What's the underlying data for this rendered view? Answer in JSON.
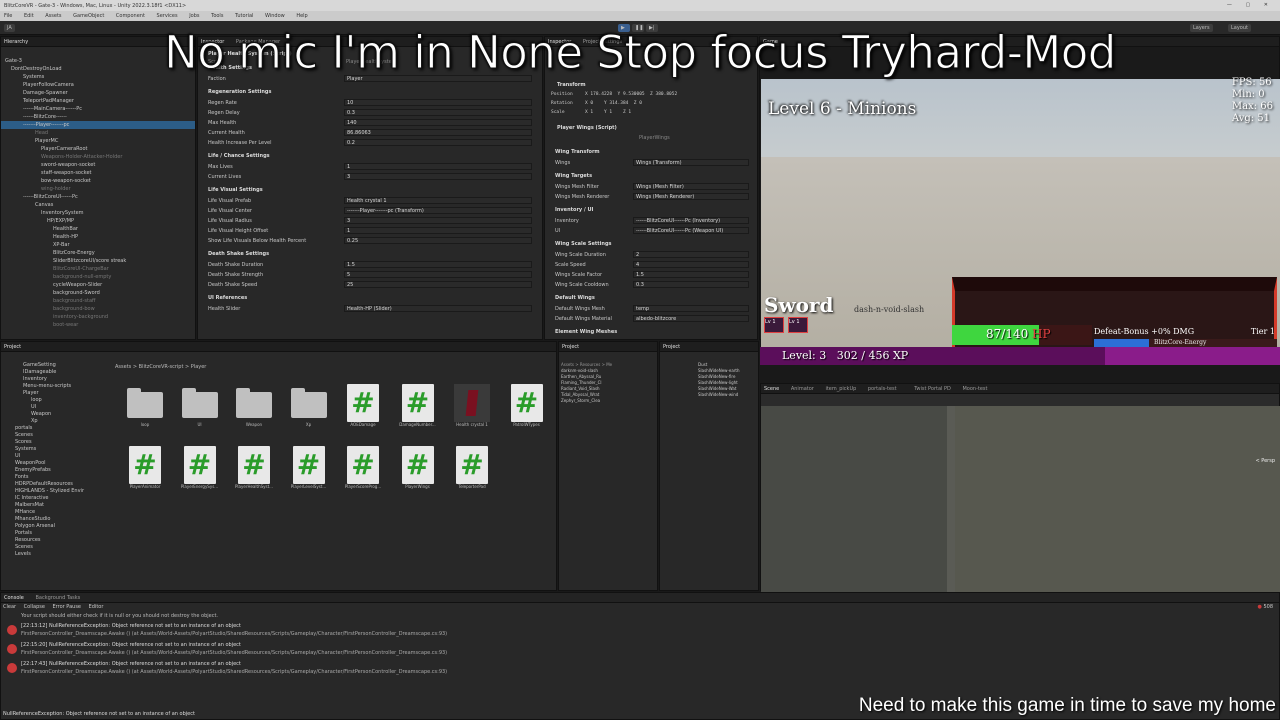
{
  "window": {
    "title": "BlitzCoreVR - Gate-3 - Windows, Mac, Linux - Unity 2022.3.18f1 <DX11>",
    "menu": [
      "File",
      "Edit",
      "Assets",
      "GameObject",
      "Component",
      "Services",
      "Jobs",
      "Tools",
      "Tutorial",
      "Window",
      "Help"
    ]
  },
  "toolbar": {
    "account": "JA",
    "layers_label": "Layers",
    "layout_label": "Layout"
  },
  "overlay": {
    "title": "No mic I'm in None Stop focus Tryhard-Mod",
    "caption": "Need to make this game in time to save my home"
  },
  "hierarchy": {
    "tab_label": "Hierarchy",
    "items": [
      {
        "label": "Gate-3",
        "dim": false
      },
      {
        "label": "DontDestroyOnLoad",
        "dim": false
      },
      {
        "label": "Systems",
        "dim": false
      },
      {
        "label": "PlayerFollowCamera",
        "dim": false
      },
      {
        "label": "Damage-Spawner",
        "dim": false
      },
      {
        "label": "TeleportPadManager",
        "dim": false
      },
      {
        "label": "------MainCamera------Pc",
        "dim": false
      },
      {
        "label": "------BlitzCore------",
        "dim": false
      },
      {
        "label": "-------Player-------pc",
        "dim": false,
        "selected": true
      },
      {
        "label": "Head",
        "dim": true
      },
      {
        "label": "PlayerMC",
        "dim": false
      },
      {
        "label": "PlayerCameraRoot",
        "dim": false
      },
      {
        "label": "Weapons-Holder-Attacker-Holder",
        "dim": true
      },
      {
        "label": "sword-weapon-socket",
        "dim": false
      },
      {
        "label": "staff-weapon-socket",
        "dim": false
      },
      {
        "label": "bow-weapon-socket",
        "dim": false
      },
      {
        "label": "wing-holder",
        "dim": true
      },
      {
        "label": "------BlitzCoreUI------Pc",
        "dim": false
      },
      {
        "label": "Canvas",
        "dim": false
      },
      {
        "label": "InventorySystem",
        "dim": false
      },
      {
        "label": "HP/EXP/MP",
        "dim": false
      },
      {
        "label": "HealthBar",
        "dim": false
      },
      {
        "label": "Health-HP",
        "dim": false
      },
      {
        "label": "XP-Bar",
        "dim": false
      },
      {
        "label": "BlitzCore-Energy",
        "dim": false
      },
      {
        "label": "SliderBlitzcoreUI/score streak",
        "dim": false
      },
      {
        "label": "BlitzCoreUI-ChargeBar",
        "dim": true
      },
      {
        "label": "background-null-empty",
        "dim": true
      },
      {
        "label": "cycleWeapon-Slider",
        "dim": false
      },
      {
        "label": "background-Sword",
        "dim": false
      },
      {
        "label": "background-staff",
        "dim": true
      },
      {
        "label": "background-bow",
        "dim": true
      },
      {
        "label": "inventory-background",
        "dim": true
      },
      {
        "label": "boot-wear",
        "dim": true
      }
    ]
  },
  "inspector": {
    "tabs": [
      "Inspector",
      "Package Manager"
    ],
    "component": "Player Health System (Script)",
    "script_label": "Script",
    "script_value": "PlayerHealthSystem",
    "sections": [
      {
        "header": "Health Settings",
        "rows": [
          {
            "label": "Faction",
            "value": "Player"
          }
        ]
      },
      {
        "header": "Regeneration Settings",
        "rows": [
          {
            "label": "Regen Rate",
            "value": "10"
          },
          {
            "label": "Regen Delay",
            "value": "0.3"
          },
          {
            "label": "Max Health",
            "value": "140"
          },
          {
            "label": "Current Health",
            "value": "86.86063"
          },
          {
            "label": "Health Increase Per Level",
            "value": "0.2"
          }
        ]
      },
      {
        "header": "Life / Chance Settings",
        "rows": [
          {
            "label": "Max Lives",
            "value": "1"
          },
          {
            "label": "Current Lives",
            "value": "3"
          }
        ]
      },
      {
        "header": "Life Visual Settings",
        "rows": [
          {
            "label": "Life Visual Prefab",
            "value": "Health crystal 1"
          },
          {
            "label": "Life Visual Center",
            "value": "-------Player-------pc (Transform)"
          },
          {
            "label": "Life Visual Radius",
            "value": "3"
          },
          {
            "label": "Life Visual Height Offset",
            "value": "1"
          },
          {
            "label": "Show Life Visuals Below Health Percent",
            "value": "0.25"
          }
        ]
      },
      {
        "header": "Death Shake Settings",
        "rows": [
          {
            "label": "Death Shake Duration",
            "value": "1.5"
          },
          {
            "label": "Death Shake Strength",
            "value": "5"
          },
          {
            "label": "Death Shake Speed",
            "value": "25"
          }
        ]
      },
      {
        "header": "UI References",
        "rows": [
          {
            "label": "Health Slider",
            "value": "Health-HP (Slider)"
          }
        ]
      }
    ]
  },
  "inspector2": {
    "tabs": [
      "Inspector",
      "Project Settings"
    ],
    "transform": {
      "header": "Transform",
      "position": [
        "178.4228",
        "9.530005",
        "380.8052"
      ],
      "rotation": [
        "0",
        "314.384",
        "0"
      ],
      "scale": [
        "1",
        "1",
        "1"
      ]
    },
    "component": "Player Wings (Script)",
    "script_value": "PlayerWings",
    "sections": [
      {
        "header": "Wing Transform",
        "rows": [
          {
            "label": "Wings",
            "value": "Wings (Transform)"
          }
        ]
      },
      {
        "header": "Wing Targets",
        "rows": [
          {
            "label": "Wings Mesh Filter",
            "value": "Wings (Mesh Filter)"
          },
          {
            "label": "Wings Mesh Renderer",
            "value": "Wings (Mesh Renderer)"
          }
        ]
      },
      {
        "header": "Inventory / UI",
        "rows": [
          {
            "label": "Inventory",
            "value": "------BlitzCoreUI------Pc (Inventory)"
          },
          {
            "label": "UI",
            "value": "------BlitzCoreUI------Pc (Weapon UI)"
          }
        ]
      },
      {
        "header": "Wing Scale Settings",
        "rows": [
          {
            "label": "Wing Scale Duration",
            "value": "2"
          },
          {
            "label": "Scale Speed",
            "value": "4"
          },
          {
            "label": "Wings Scale Factor",
            "value": "1.5"
          },
          {
            "label": "Wing Scale Cooldown",
            "value": "0.3"
          }
        ]
      },
      {
        "header": "Default Wings",
        "rows": [
          {
            "label": "Default Wings Mesh",
            "value": "temp"
          },
          {
            "label": "Default Wings Material",
            "value": "albedo-blitzcore"
          }
        ]
      },
      {
        "header": "Element Wing Meshes",
        "rows": []
      }
    ]
  },
  "game": {
    "tabs": [
      "Game"
    ],
    "level_title": "Level 6 - Minions",
    "fps": "FPS: 56",
    "min": "Min: 0",
    "max": "Max: 66",
    "avg": "Avg: 51",
    "weapon": "Sword",
    "dash_text": "dash-n-void-slash",
    "slot_labels": [
      "Lv 1",
      "Lv 1"
    ],
    "player_level": "Level: 3",
    "xp_text": "302 / 456 XP",
    "xp_current": 302,
    "xp_max": 456,
    "hp_text": "87/140",
    "hp_unit": "HP",
    "hp_current": 87,
    "hp_max": 140,
    "defeat_text": "Defeat-Bonus +0% DMG",
    "tier_text": "Tier 1",
    "energy_text": "BlitzCore-Energy",
    "energy_fill": 0.3
  },
  "project": {
    "tabs": [
      "Project"
    ],
    "breadcrumb": "Assets > BlitzCoreVR-script > Player",
    "folders": [
      "GameSetting",
      "IDamageable",
      "Inventory",
      "Menu-menu-scripts",
      "Player",
      "loop",
      "UI",
      "Weapon",
      "Xp",
      "portals",
      "Scenes",
      "Scores",
      "Systems",
      "UI",
      "WeaponPool",
      "EnemyPrefabs",
      "Fonts",
      "HDRPDefaultResources",
      "HIGHLANDS - Stylized Envir",
      "IC Interactive",
      "MalbersMat",
      "MHance",
      "MhanceStudio",
      "Polygon Arsenal",
      "Portals",
      "Resources",
      "Scenes",
      "Levels"
    ],
    "assets_row1": [
      {
        "name": "loop",
        "type": "folder"
      },
      {
        "name": "UI",
        "type": "folder"
      },
      {
        "name": "Weapon",
        "type": "folder"
      },
      {
        "name": "Xp",
        "type": "folder"
      },
      {
        "name": "AOEDamage",
        "type": "script"
      },
      {
        "name": "DamageNumber...",
        "type": "script"
      },
      {
        "name": "Health crystal 1",
        "type": "material"
      },
      {
        "name": "PatrolWTypes",
        "type": "script"
      }
    ],
    "assets_row2": [
      {
        "name": "PlayerAnimator",
        "type": "script"
      },
      {
        "name": "PlayerEnergySys...",
        "type": "script"
      },
      {
        "name": "PlayerHealthSyst...",
        "type": "script"
      },
      {
        "name": "PlayerLevelSyst...",
        "type": "script"
      },
      {
        "name": "PlayerScoreProg...",
        "type": "script"
      },
      {
        "name": "PlayerWings",
        "type": "script"
      },
      {
        "name": "TeleporterPad",
        "type": "script"
      }
    ]
  },
  "project2": {
    "tabs": [
      "Project"
    ],
    "path": "Assets > Resources > Me",
    "items": [
      "darknm-void-slash",
      "Earthen_Abyssal_Ru",
      "Flaming_Thunder_Cl",
      "Radiant_Void_Slash",
      "Tidal_Abyssal_Wrat",
      "Zephyr_Storm_Clea"
    ]
  },
  "project3": {
    "tabs": [
      "Project"
    ],
    "items": [
      "Dust",
      "SlashWideNew-earth",
      "SlashWideNew-fire",
      "SlashWideNew-light",
      "SlashWideNew-Wat",
      "SlashWideNew-wind"
    ]
  },
  "scene": {
    "tabs": [
      "Scene",
      "Animator",
      "item_pickUp",
      "portals-test"
    ],
    "tabs_right": [
      "Twist Portal PD",
      "Moon-test"
    ],
    "persp_label": "< Persp"
  },
  "console": {
    "tabs": [
      "Console",
      "Background Tasks"
    ],
    "buttons": [
      "Clear",
      "Collapse",
      "Error Pause",
      "Editor"
    ],
    "count": "508",
    "warning_line": "Your script should either check if it is null or you should not destroy the object.",
    "messages": [
      {
        "time": "[22:13:12]",
        "text": "NullReferenceException: Object reference not set to an instance of an object",
        "detail": "FirstPersonController_Dreamscape.Awake () (at Assets/World-Assets/PolyartStudio/SharedResources/Scripts/Gameplay/Character/FirstPersonController_Dreamscape.cs:93)"
      },
      {
        "time": "[22:15:20]",
        "text": "NullReferenceException: Object reference not set to an instance of an object",
        "detail": "FirstPersonController_Dreamscape.Awake () (at Assets/World-Assets/PolyartStudio/SharedResources/Scripts/Gameplay/Character/FirstPersonController_Dreamscape.cs:93)"
      },
      {
        "time": "[22:17:43]",
        "text": "NullReferenceException: Object reference not set to an instance of an object",
        "detail": "FirstPersonController_Dreamscape.Awake () (at Assets/World-Assets/PolyartStudio/SharedResources/Scripts/Gameplay/Character/FirstPersonController_Dreamscape.cs:93)"
      }
    ],
    "status": "NullReferenceException: Object reference not set to an instance of an object"
  }
}
